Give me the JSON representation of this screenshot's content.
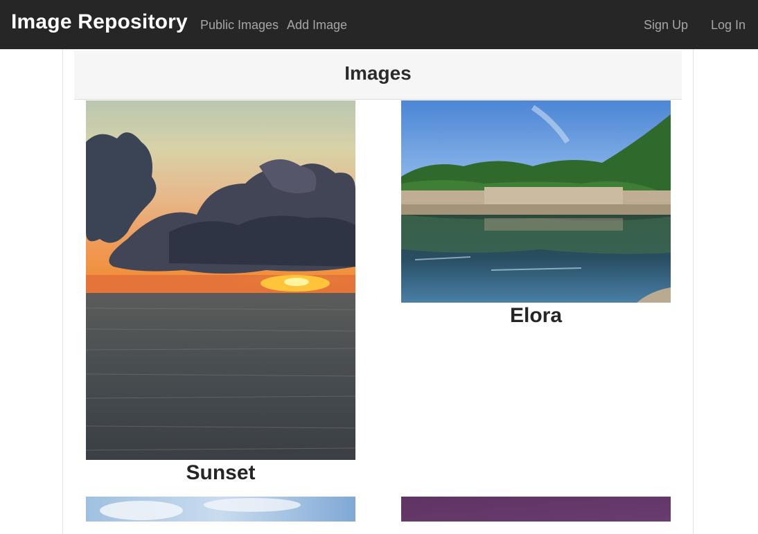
{
  "navbar": {
    "brand": "Image Repository",
    "links": [
      "Public Images",
      "Add Image"
    ],
    "right_links": [
      "Sign Up",
      "Log In"
    ]
  },
  "main": {
    "header": "Images",
    "images": [
      {
        "caption": "Sunset"
      },
      {
        "caption": "Elora"
      },
      {
        "caption": ""
      },
      {
        "caption": ""
      }
    ]
  }
}
